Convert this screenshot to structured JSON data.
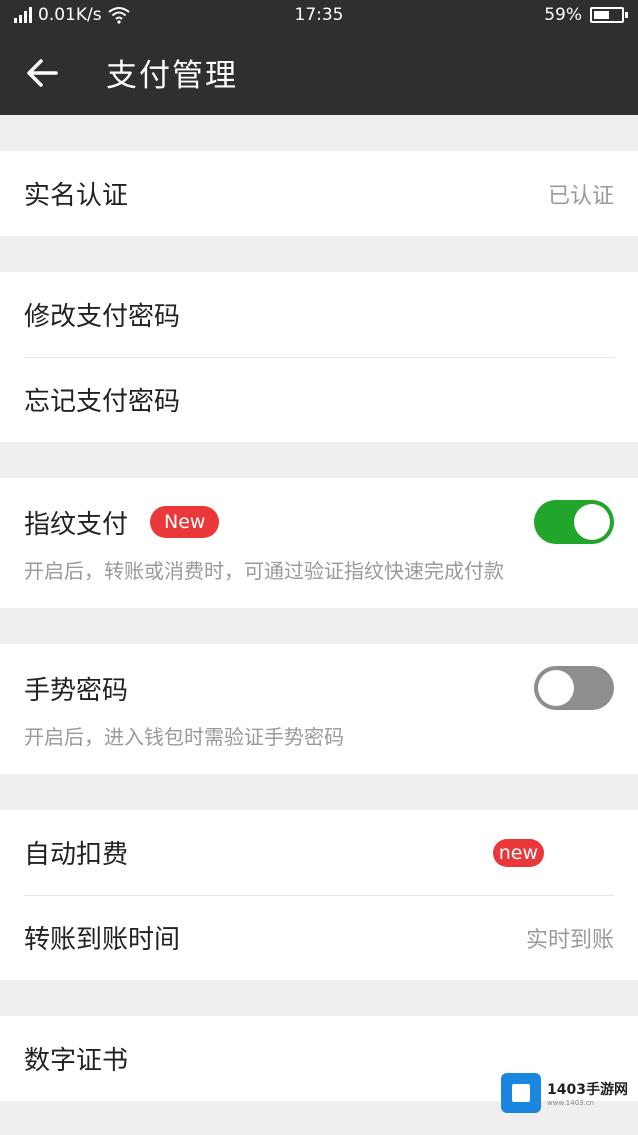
{
  "status_bar": {
    "network": "0.01K/s",
    "time": "17:35",
    "battery": "59%",
    "battery_level": 0.59
  },
  "app_bar": {
    "title": "支付管理",
    "back_icon": "arrow-left-icon"
  },
  "groups": {
    "verification": {
      "label": "实名认证",
      "value": "已认证"
    },
    "password": {
      "change_label": "修改支付密码",
      "forgot_label": "忘记支付密码"
    },
    "fingerprint": {
      "label": "指纹支付",
      "badge": "New",
      "enabled": true,
      "description": "开启后，转账或消费时，可通过验证指纹快速完成付款"
    },
    "gesture": {
      "label": "手势密码",
      "enabled": false,
      "description": "开启后，进入钱包时需验证手势密码"
    },
    "billing": {
      "auto_label": "自动扣费",
      "auto_badge": "new",
      "transfer_label": "转账到账时间",
      "transfer_value": "实时到账"
    },
    "certificate": {
      "label": "数字证书"
    }
  },
  "watermark": {
    "title": "1403手游网",
    "subtitle": "www.1403.cn"
  },
  "colors": {
    "header_bg": "#2f2f2f",
    "toggle_on": "#22a52b",
    "toggle_off": "#8e8e8e",
    "badge": "#e9373a",
    "page_bg": "#efefef"
  }
}
